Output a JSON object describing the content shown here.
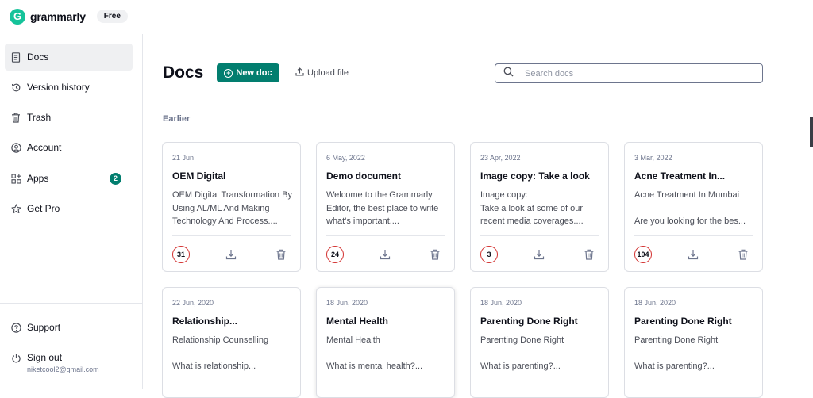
{
  "header": {
    "brand": "grammarly",
    "logo_letter": "G",
    "plan_badge": "Free"
  },
  "sidebar": {
    "items": [
      {
        "label": "Docs",
        "icon": "doc-icon",
        "active": true
      },
      {
        "label": "Version history",
        "icon": "history-icon"
      },
      {
        "label": "Trash",
        "icon": "trash-icon"
      },
      {
        "label": "Account",
        "icon": "account-icon"
      },
      {
        "label": "Apps",
        "icon": "apps-icon",
        "badge": "2"
      },
      {
        "label": "Get Pro",
        "icon": "star-icon"
      }
    ],
    "footer": {
      "support_label": "Support",
      "signout_label": "Sign out",
      "email": "niketcool2@gmail.com"
    }
  },
  "main": {
    "title": "Docs",
    "new_doc_label": "New doc",
    "upload_label": "Upload file",
    "search_placeholder": "Search docs",
    "section_label": "Earlier",
    "cards": [
      {
        "date": "21 Jun",
        "title": "OEM Digital",
        "preview": "OEM Digital Transformation By Using AL/ML And Making Technology And Process....",
        "score": "31"
      },
      {
        "date": "6 May, 2022",
        "title": "Demo document",
        "preview": "Welcome to the Grammarly Editor, the best place to write what's important....",
        "score": "24"
      },
      {
        "date": "23 Apr, 2022",
        "title": "Image copy: Take a look",
        "preview": "Image copy:\nTake a look at some of our recent media coverages....",
        "score": "3"
      },
      {
        "date": "3 Mar, 2022",
        "title": "Acne Treatment In...",
        "preview": "Acne Treatment In Mumbai\n\nAre you looking for the bes...",
        "score": "104"
      },
      {
        "date": "22 Jun, 2020",
        "title": "Relationship...",
        "preview": "Relationship Counselling\n\nWhat is relationship..."
      },
      {
        "date": "18 Jun, 2020",
        "title": "Mental Health",
        "preview": "Mental Health\n\nWhat is mental health?..."
      },
      {
        "date": "18 Jun, 2020",
        "title": "Parenting Done Right",
        "preview": "Parenting Done Right\n\nWhat is parenting?..."
      },
      {
        "date": "18 Jun, 2020",
        "title": "Parenting Done Right",
        "preview": "Parenting Done Right\n\nWhat is parenting?..."
      }
    ]
  },
  "colors": {
    "accent": "#027e6f",
    "brand": "#15c39a",
    "score_ring": "#d3302f"
  }
}
